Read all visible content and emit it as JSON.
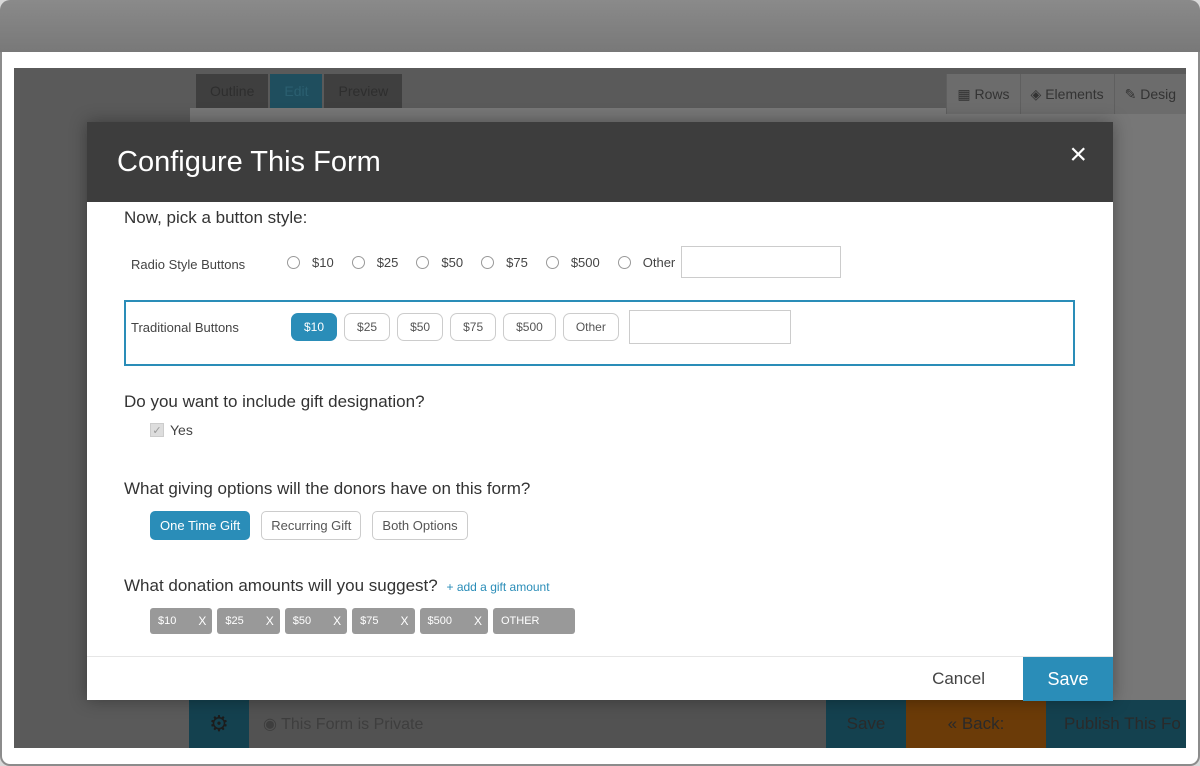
{
  "background": {
    "tabs": [
      "Outline",
      "Edit",
      "Preview"
    ],
    "tools": [
      {
        "icon": "rows-icon",
        "label": "Rows"
      },
      {
        "icon": "elements-icon",
        "label": "Elements"
      },
      {
        "icon": "design-icon",
        "label": "Desig"
      }
    ],
    "bottom": {
      "private_label": "This Form is Private",
      "save_label": "Save",
      "back_label": "« Back: Setup",
      "publish_label": "Publish This Fo"
    }
  },
  "modal": {
    "title": "Configure This Form",
    "close_label": "×",
    "button_style_question": "Now, pick a button style:",
    "radio_row_label": "Radio Style Buttons",
    "radio_options": [
      "$10",
      "$25",
      "$50",
      "$75",
      "$500",
      "Other"
    ],
    "traditional_row_label": "Traditional Buttons",
    "traditional_options": [
      "$10",
      "$25",
      "$50",
      "$75",
      "$500",
      "Other"
    ],
    "traditional_selected": "$10",
    "designation_question": "Do you want to include gift designation?",
    "designation_checkbox_label": "Yes",
    "giving_question": "What giving options will the donors have on this form?",
    "giving_options": [
      "One Time Gift",
      "Recurring Gift",
      "Both Options"
    ],
    "giving_selected": "One Time Gift",
    "amounts_question": "What donation amounts will you suggest?",
    "add_amount_link": "+ add a gift amount",
    "amount_chips": [
      "$10",
      "$25",
      "$50",
      "$75",
      "$500"
    ],
    "amount_other_chip": "OTHER",
    "chip_remove_label": "X",
    "cancel_label": "Cancel",
    "save_label": "Save"
  }
}
